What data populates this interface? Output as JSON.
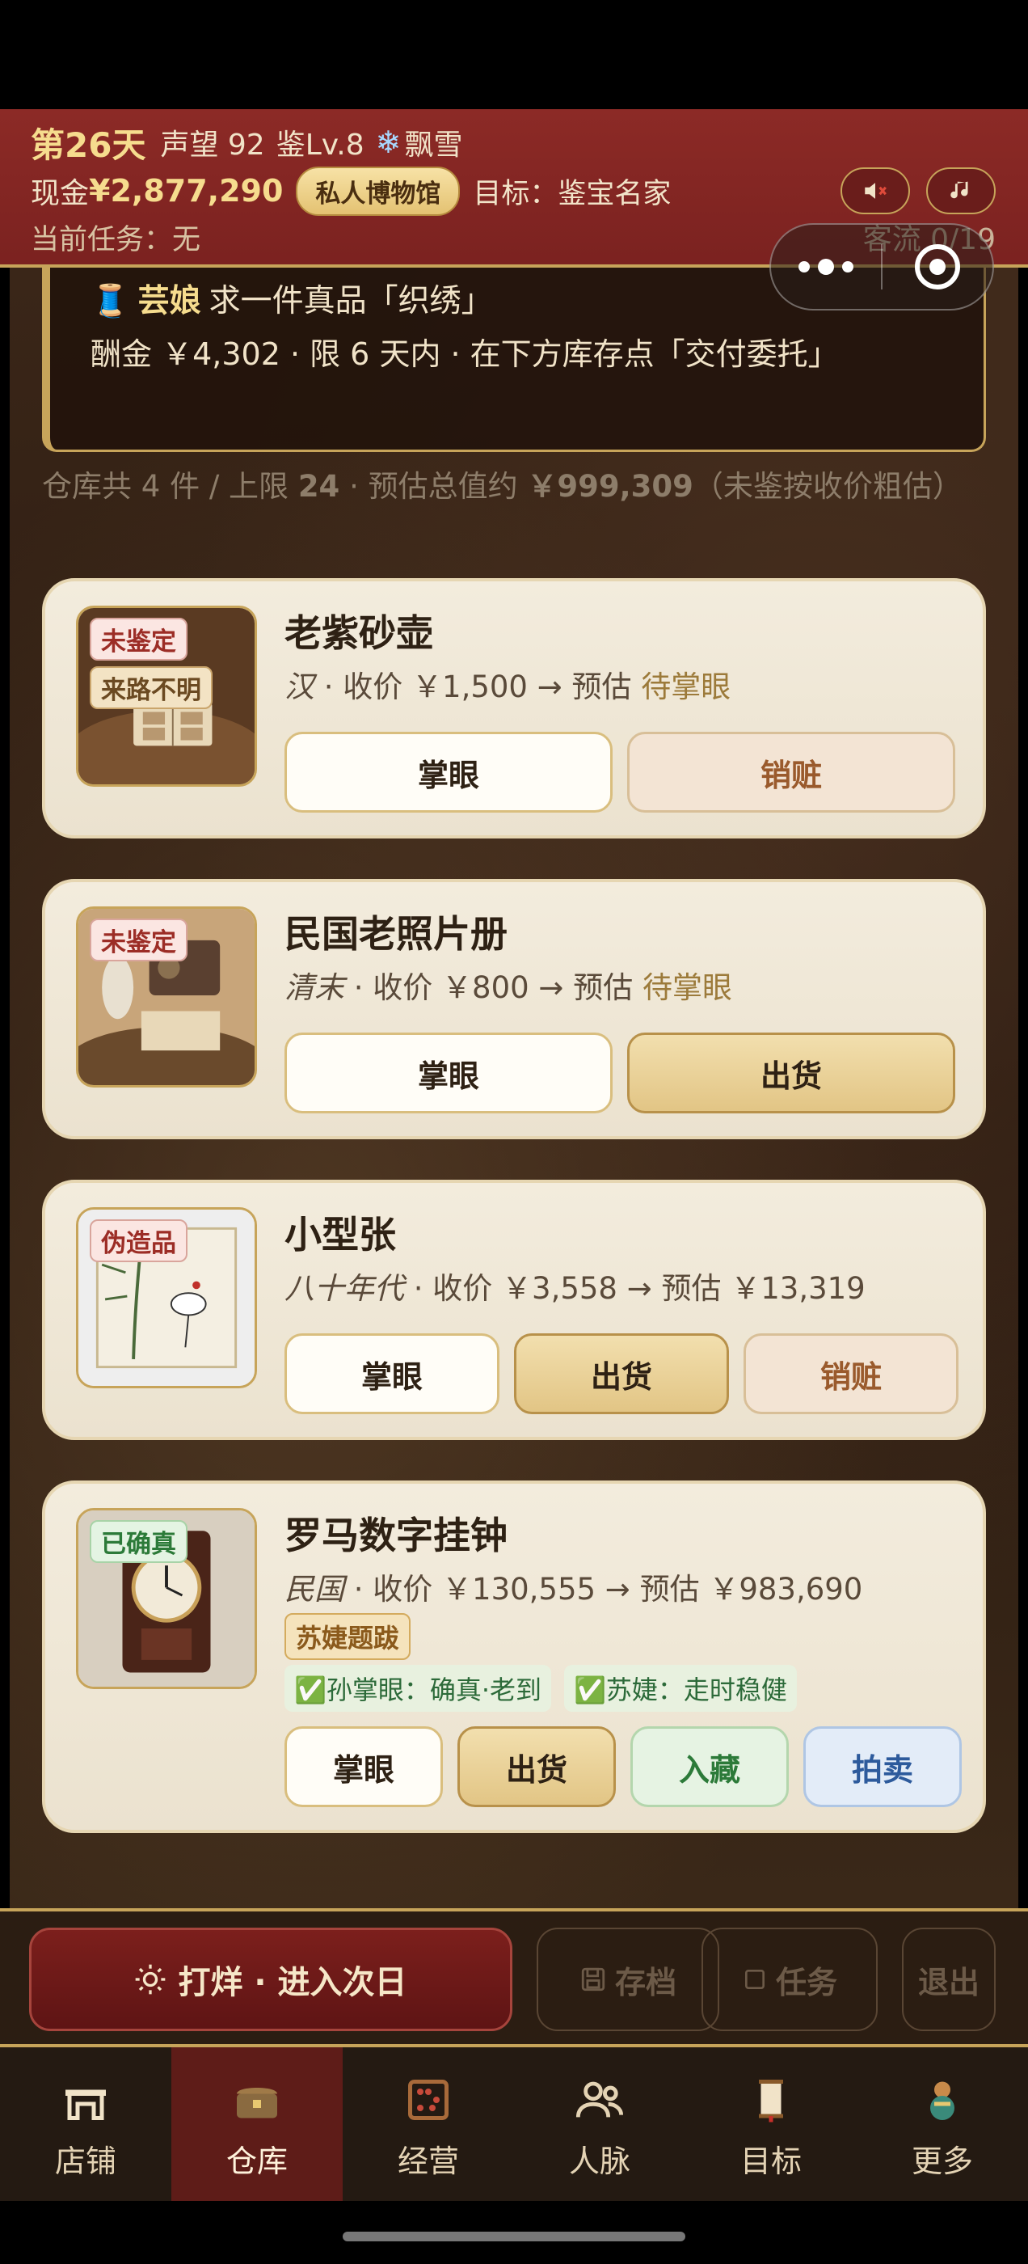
{
  "header": {
    "day": "第26天",
    "reputation": "声望 92",
    "level": "鉴Lv.8",
    "weather": "飘雪",
    "cash_label": "现金",
    "cash": "¥2,877,290",
    "museum": "私人博物馆",
    "goal": "目标：鉴宝名家",
    "task": "当前任务：无",
    "visitors": "客流 0/19",
    "mute_icon": "speaker-mute-icon",
    "music_icon": "music-note-icon"
  },
  "commission": {
    "client": "芸娘",
    "request": "求一件真品「织绣」",
    "detail": "酬金 ￥4,302 · 限 6 天内 · 在下方库存点「交付委托」"
  },
  "inventory": {
    "summary_prefix": "仓库共 4 件 / 上限 ",
    "limit": "24",
    "summary_mid": " · 预估总值约 ",
    "total": "￥999,309",
    "summary_suffix": "（未鉴按收价粗估）"
  },
  "items": [
    {
      "tags": [
        "未鉴定",
        "来路不明"
      ],
      "title": "老紫砂壶",
      "era": "汉",
      "price": " · 收价 ￥1,500 → 预估 ",
      "estimate": "待掌眼",
      "buttons": [
        "掌眼",
        "销赃"
      ]
    },
    {
      "tags": [
        "未鉴定"
      ],
      "title": "民国老照片册",
      "era": "清末",
      "price": " · 收价 ￥800 → 预估 ",
      "estimate": "待掌眼",
      "buttons": [
        "掌眼",
        "出货"
      ]
    },
    {
      "tags": [
        "伪造品"
      ],
      "title": "小型张",
      "era": "八十年代",
      "price": " · 收价 ￥3,558 → 预估 ￥13,319",
      "estimate": "",
      "buttons": [
        "掌眼",
        "出货",
        "销赃"
      ]
    },
    {
      "tags": [
        "已确真"
      ],
      "title": "罗马数字挂钟",
      "era": "民国",
      "price": " · 收价 ￥130,555 → 预估 ￥983,690",
      "estimate": "",
      "annotation": "苏婕题跋",
      "opinions": [
        "✅孙掌眼：确真·老到",
        "✅苏婕：走时稳健"
      ],
      "buttons": [
        "掌眼",
        "出货",
        "入藏",
        "拍卖"
      ]
    }
  ],
  "actions": {
    "next_day": "打烊 · 进入次日",
    "save": "存档",
    "tasks": "任务",
    "exit": "退出"
  },
  "tabs": [
    {
      "label": "店铺",
      "icon": "shop-icon"
    },
    {
      "label": "仓库",
      "icon": "warehouse-chest-icon"
    },
    {
      "label": "经营",
      "icon": "abacus-icon"
    },
    {
      "label": "人脉",
      "icon": "people-icon"
    },
    {
      "label": "目标",
      "icon": "scroll-icon"
    },
    {
      "label": "更多",
      "icon": "gourd-icon"
    }
  ],
  "colors": {
    "header_red": "#8c2a26",
    "gold": "#c7a45a",
    "card_bg": "#f3ecdd",
    "active_tab": "#5e1c18"
  }
}
